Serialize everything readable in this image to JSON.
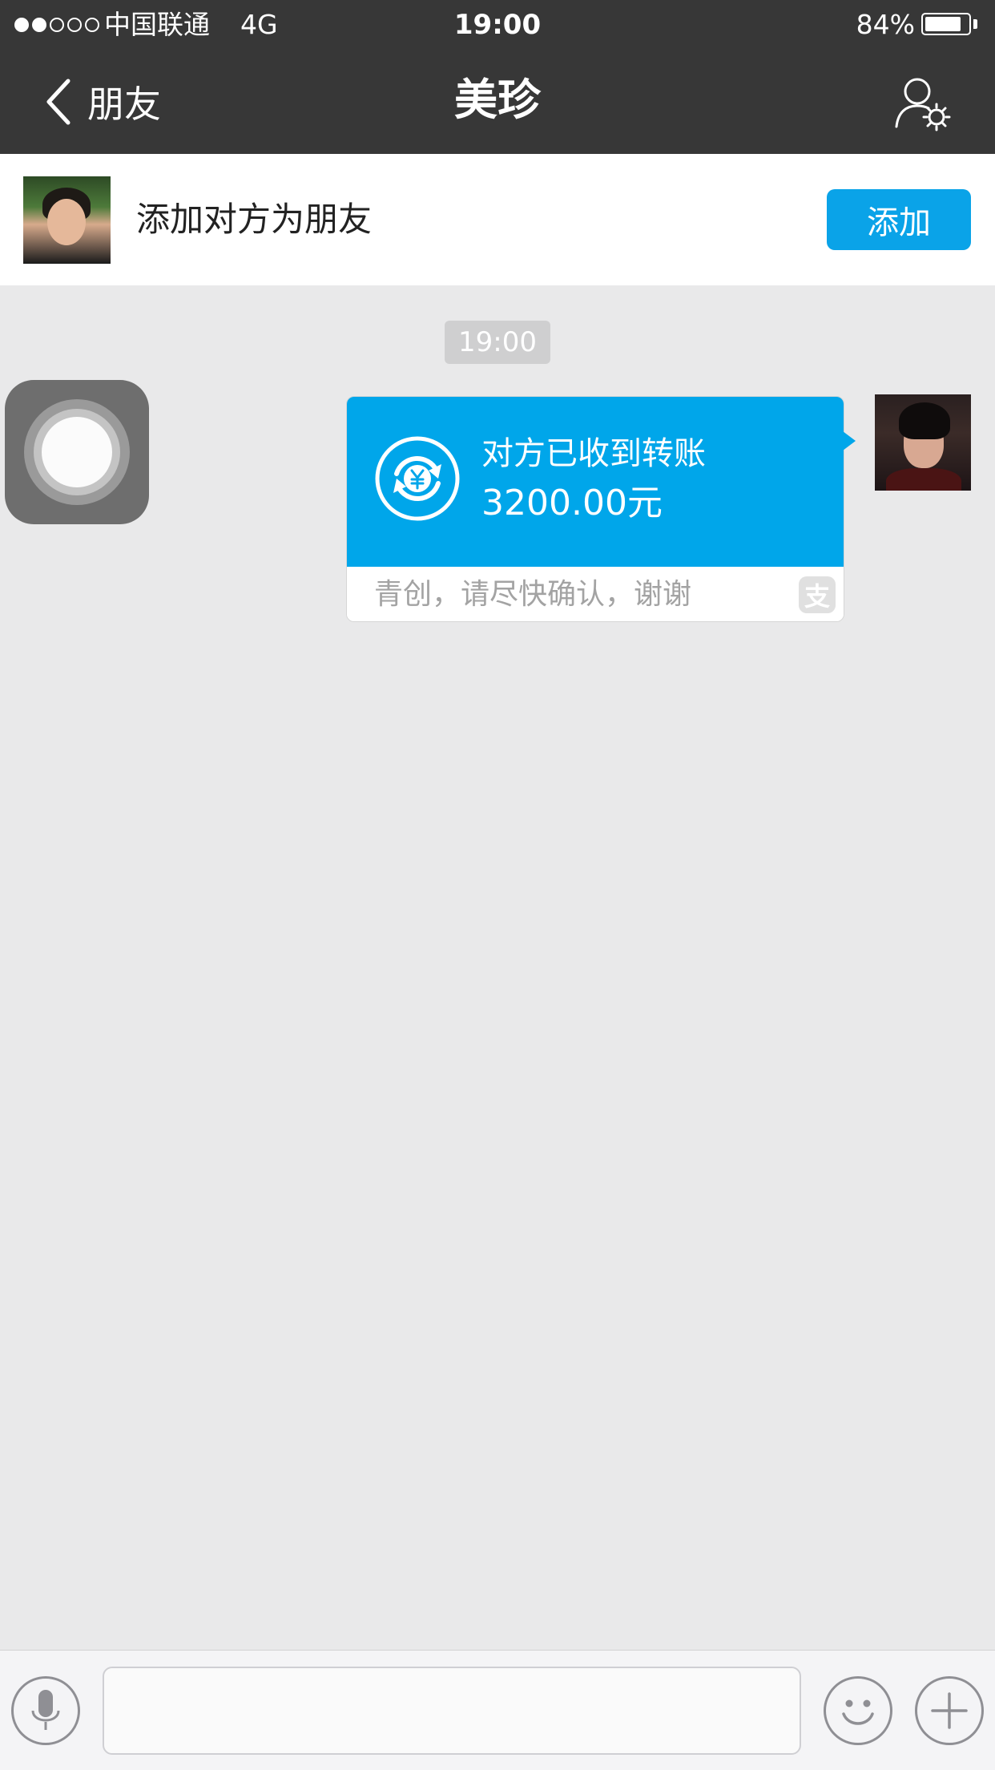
{
  "status_bar": {
    "signal_bars_filled": 2,
    "signal_bars_total": 5,
    "carrier": "中国联通",
    "network": "4G",
    "time": "19:00",
    "battery": "84%",
    "battery_level": 0.84
  },
  "nav": {
    "back_label": "朋友",
    "title": "美珍",
    "back_icon": "chevron-left-icon",
    "profile_icon": "user-settings-icon"
  },
  "add_friend": {
    "prompt": "添加对方为朋友",
    "button_label": "添加"
  },
  "chat": {
    "timestamp": "19:00",
    "transfer": {
      "status": "对方已收到转账",
      "amount": "3200.00元",
      "note": "青创，请尽快确认，谢谢",
      "source_icon_glyph": "支",
      "icon": "yuan-transfer-icon"
    }
  },
  "input_bar": {
    "voice_icon": "microphone-icon",
    "emoji_icon": "smiley-icon",
    "plus_icon": "plus-icon",
    "message_value": ""
  },
  "colors": {
    "bar_bg": "#373737",
    "accent": "#00a6ea",
    "chat_bg": "#e9e9ea"
  }
}
